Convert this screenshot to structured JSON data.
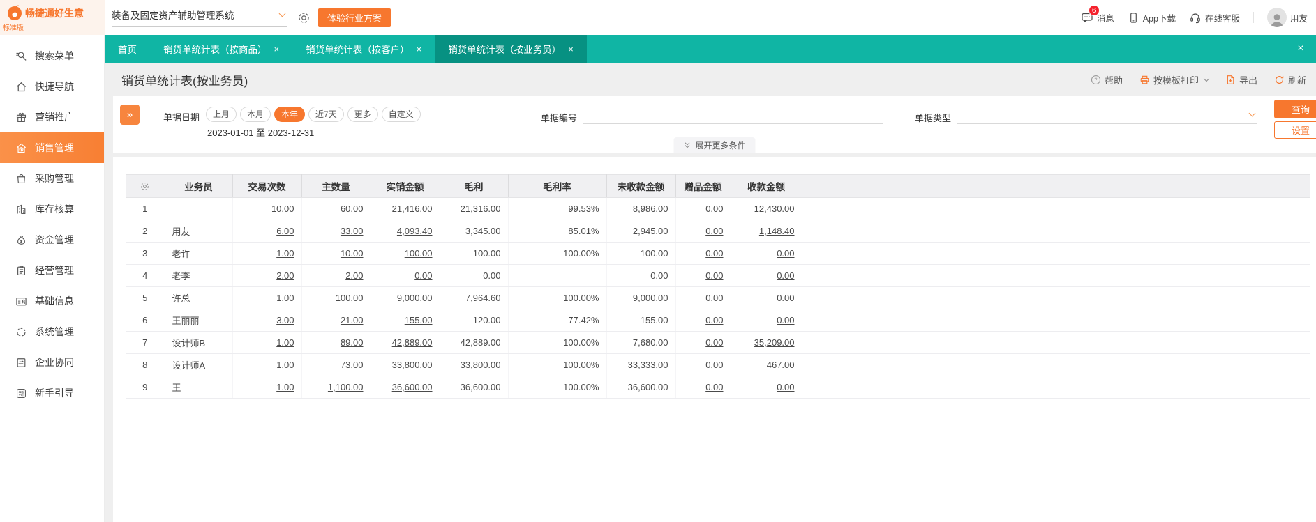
{
  "colors": {
    "accent_orange": "#f7772e",
    "teal_tabbar": "#10b5a4",
    "teal_active_tab": "#079182",
    "badge_red": "#f5222d",
    "sidebar_active": "#f87f33"
  },
  "topbar": {
    "logo_title": "畅捷通好生意",
    "logo_subtitle": "标准版",
    "system_selector": "装备及固定资产辅助管理系统",
    "trial_button": "体验行业方案",
    "message_label": "消息",
    "message_badge": "6",
    "app_download_label": "App下载",
    "online_service_label": "在线客服",
    "user_name": "用友"
  },
  "sidebar": {
    "items": [
      {
        "label": "搜索菜单",
        "icon": "search-icon"
      },
      {
        "label": "快捷导航",
        "icon": "home-icon"
      },
      {
        "label": "营销推广",
        "icon": "gift-icon"
      },
      {
        "label": "销售管理",
        "icon": "sales-house-icon",
        "active": true
      },
      {
        "label": "采购管理",
        "icon": "purchase-bag-icon"
      },
      {
        "label": "库存核算",
        "icon": "warehouse-icon"
      },
      {
        "label": "资金管理",
        "icon": "money-bag-icon"
      },
      {
        "label": "经营管理",
        "icon": "clipboard-icon"
      },
      {
        "label": "基础信息",
        "icon": "id-card-icon"
      },
      {
        "label": "系统管理",
        "icon": "system-circle-icon"
      },
      {
        "label": "企业协同",
        "icon": "collab-icon"
      },
      {
        "label": "新手引导",
        "icon": "guide-icon"
      }
    ]
  },
  "tabbar": {
    "tabs": [
      {
        "label": "首页",
        "close_icon": "",
        "active": false
      },
      {
        "label": "销货单统计表（按商品）",
        "close_icon": "×",
        "active": false
      },
      {
        "label": "销货单统计表（按客户）",
        "close_icon": "×",
        "active": false
      },
      {
        "label": "销货单统计表（按业务员）",
        "close_icon": "×",
        "active": true
      }
    ],
    "close_all_icon": "×"
  },
  "page": {
    "title": "销货单统计表(按业务员)",
    "toolbar": {
      "help": "帮助",
      "print": "按模板打印",
      "export": "导出",
      "refresh": "刷新"
    }
  },
  "filters": {
    "date_label": "单据日期",
    "date_pills": [
      {
        "label": "上月",
        "active": false
      },
      {
        "label": "本月",
        "active": false
      },
      {
        "label": "本年",
        "active": true
      },
      {
        "label": "近7天",
        "active": false
      },
      {
        "label": "更多",
        "active": false
      },
      {
        "label": "自定义",
        "active": false
      }
    ],
    "date_range": "2023-01-01 至 2023-12-31",
    "doc_no_label": "单据编号",
    "doc_type_label": "单据类型",
    "query_button": "查询",
    "settings_button": "设置",
    "expand_more_label": "展开更多条件",
    "collapse_glyph": "»"
  },
  "table": {
    "columns": [
      "业务员",
      "交易次数",
      "主数量",
      "实销金额",
      "毛利",
      "毛利率",
      "未收款金额",
      "赠品金额",
      "收款金额"
    ],
    "rows": [
      {
        "no": "1",
        "name": "",
        "values": [
          "10.00",
          "60.00",
          "21,416.00",
          "21,316.00",
          "99.53%",
          "8,986.00",
          "0.00",
          "12,430.00"
        ]
      },
      {
        "no": "2",
        "name": "用友",
        "values": [
          "6.00",
          "33.00",
          "4,093.40",
          "3,345.00",
          "85.01%",
          "2,945.00",
          "0.00",
          "1,148.40"
        ]
      },
      {
        "no": "3",
        "name": "老许",
        "values": [
          "1.00",
          "10.00",
          "100.00",
          "100.00",
          "100.00%",
          "100.00",
          "0.00",
          "0.00"
        ]
      },
      {
        "no": "4",
        "name": "老李",
        "values": [
          "2.00",
          "2.00",
          "0.00",
          "0.00",
          "",
          "0.00",
          "0.00",
          "0.00"
        ]
      },
      {
        "no": "5",
        "name": "许总",
        "values": [
          "1.00",
          "100.00",
          "9,000.00",
          "7,964.60",
          "100.00%",
          "9,000.00",
          "0.00",
          "0.00"
        ]
      },
      {
        "no": "6",
        "name": "王丽丽",
        "values": [
          "3.00",
          "21.00",
          "155.00",
          "120.00",
          "77.42%",
          "155.00",
          "0.00",
          "0.00"
        ]
      },
      {
        "no": "7",
        "name": "设计师B",
        "values": [
          "1.00",
          "89.00",
          "42,889.00",
          "42,889.00",
          "100.00%",
          "7,680.00",
          "0.00",
          "35,209.00"
        ]
      },
      {
        "no": "8",
        "name": "设计师A",
        "values": [
          "1.00",
          "73.00",
          "33,800.00",
          "33,800.00",
          "100.00%",
          "33,333.00",
          "0.00",
          "467.00"
        ]
      },
      {
        "no": "9",
        "name": "王",
        "values": [
          "1.00",
          "1,100.00",
          "36,600.00",
          "36,600.00",
          "100.00%",
          "36,600.00",
          "0.00",
          "0.00"
        ]
      }
    ]
  }
}
